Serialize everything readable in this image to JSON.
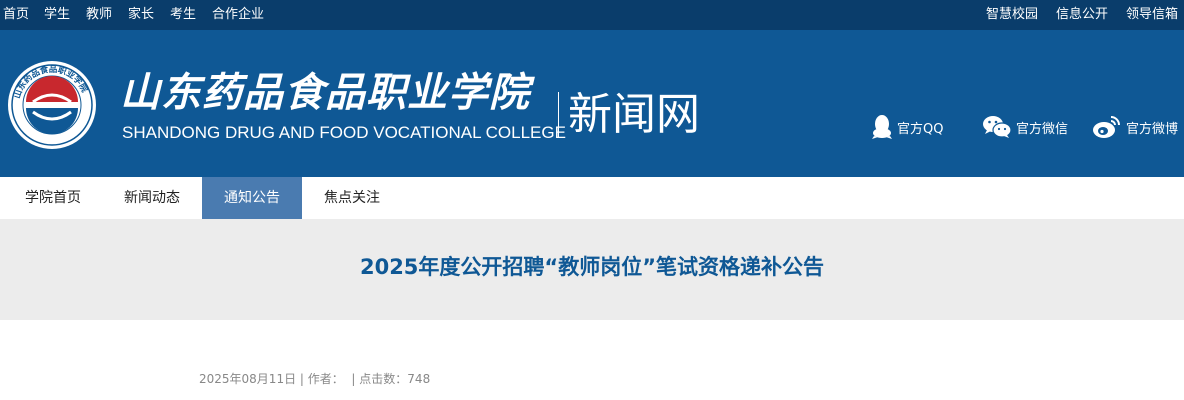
{
  "topbar": {
    "left_links": [
      "首页",
      "学生",
      "教师",
      "家长",
      "考生",
      "合作企业"
    ],
    "right_links": [
      "智慧校园",
      "信息公开",
      "领导信箱"
    ]
  },
  "header": {
    "college_name_cn": "山东药品食品职业学院",
    "college_name_en": "SHANDONG DRUG AND FOOD VOCATIONAL COLLEGE",
    "site_title": "新闻网",
    "logo_ring_text": "山东药品食品职业学院",
    "social": [
      {
        "label": "官方QQ",
        "icon": "qq-icon"
      },
      {
        "label": "官方微信",
        "icon": "wechat-icon"
      },
      {
        "label": "官方微博",
        "icon": "weibo-icon"
      }
    ]
  },
  "nav": {
    "items": [
      "学院首页",
      "新闻动态",
      "通知公告",
      "焦点关注"
    ],
    "active_index": 2
  },
  "article": {
    "title": "2025年度公开招聘“教师岗位”笔试资格递补公告",
    "date": "2025年08月11日",
    "author_label": "作者：",
    "hits_label": "点击数：",
    "hits": "748"
  },
  "colors": {
    "topbar": "#0a3d6b",
    "header": "#0f5895",
    "nav_active": "#4a7bb0",
    "title_band": "#ececec",
    "title_text": "#0f5895"
  }
}
